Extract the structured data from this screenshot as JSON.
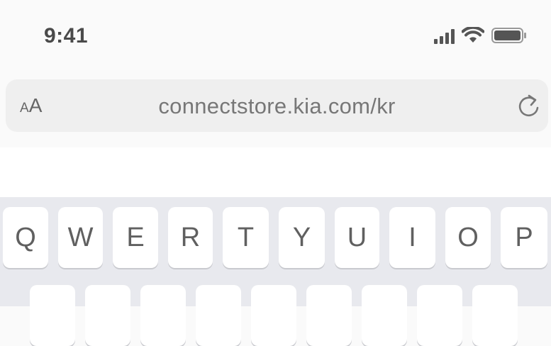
{
  "status_bar": {
    "time": "9:41",
    "icons": [
      "cellular-signal-icon",
      "wifi-icon",
      "battery-icon"
    ]
  },
  "address_bar": {
    "text_size_label_small": "A",
    "text_size_label_large": "A",
    "url": "connectstore.kia.com/kr",
    "reload_icon": "reload-icon"
  },
  "keyboard": {
    "row1": [
      "Q",
      "W",
      "E",
      "R",
      "T",
      "Y",
      "U",
      "I",
      "O",
      "P"
    ]
  },
  "colors": {
    "page_bg": "#fafafa",
    "address_bg": "#efefef",
    "keyboard_bg": "#e8e9ee",
    "key_bg": "#ffffff",
    "text_gray": "#777777"
  }
}
